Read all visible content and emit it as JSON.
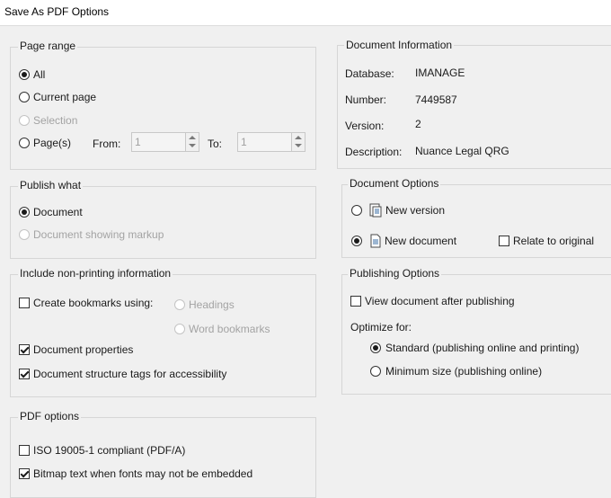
{
  "window": {
    "title": "Save As PDF Options"
  },
  "page_range": {
    "label": "Page range",
    "all": "All",
    "current_page": "Current page",
    "selection": "Selection",
    "pages": "Page(s)",
    "from_label": "From:",
    "from_value": "1",
    "to_label": "To:",
    "to_value": "1",
    "selected": "All"
  },
  "publish_what": {
    "label": "Publish what",
    "document": "Document",
    "document_markup": "Document showing markup",
    "selected": "Document"
  },
  "non_printing": {
    "label": "Include non-printing information",
    "create_bookmarks": "Create bookmarks using:",
    "create_bookmarks_checked": false,
    "headings": "Headings",
    "word_bookmarks": "Word bookmarks",
    "doc_properties": "Document properties",
    "doc_properties_checked": true,
    "structure_tags": "Document structure tags for accessibility",
    "structure_tags_checked": true
  },
  "pdf_options": {
    "label": "PDF options",
    "iso": "ISO 19005-1 compliant (PDF/A)",
    "iso_checked": false,
    "bitmap": "Bitmap text when fonts may not be embedded",
    "bitmap_checked": true
  },
  "doc_info": {
    "label": "Document Information",
    "database_label": "Database:",
    "database_value": "IMANAGE",
    "number_label": "Number:",
    "number_value": "7449587",
    "version_label": "Version:",
    "version_value": "2",
    "description_label": "Description:",
    "description_value": "Nuance Legal QRG"
  },
  "doc_options": {
    "label": "Document Options",
    "new_version": "New version",
    "new_document": "New document",
    "relate": "Relate to original",
    "relate_checked": false,
    "selected": "New document"
  },
  "publishing": {
    "label": "Publishing Options",
    "view_after": "View document after publishing",
    "view_after_checked": false,
    "optimize_label": "Optimize for:",
    "standard": "Standard (publishing online and printing)",
    "minimum": "Minimum size (publishing online)",
    "selected": "Standard"
  },
  "icons": {
    "radio": "radio-icon",
    "checkbox": "checkbox-icon",
    "document": "new-document-icon",
    "version": "new-version-icon"
  }
}
